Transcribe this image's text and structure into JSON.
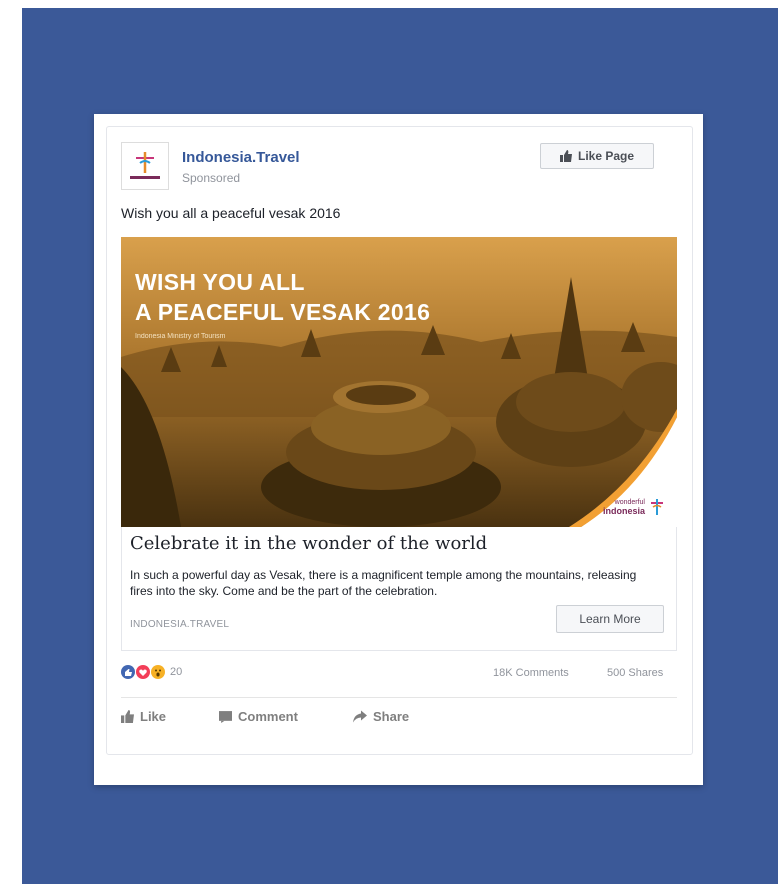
{
  "post": {
    "page_name": "Indonesia.Travel",
    "sponsored_label": "Sponsored",
    "like_page_label": "Like Page",
    "text": "Wish you all a peaceful vesak 2016"
  },
  "hero": {
    "title_line1": "WISH YOU ALL",
    "title_line2": "A PEACEFUL VESAK 2016",
    "subtitle": "Indonesia Ministry of Tourism",
    "logo_top": "wonderful",
    "logo_bottom": "indonesia"
  },
  "link": {
    "title": "Celebrate it in the wonder of the world",
    "description": "In such a powerful day as Vesak, there is a magnificent temple among the mountains, releasing fires into the sky. Come and be the part of the celebration.",
    "domain": "INDONESIA.TRAVEL",
    "cta_label": "Learn More"
  },
  "stats": {
    "reaction_count": "20",
    "comments": "18K Comments",
    "shares": "500 Shares",
    "reactions": [
      "like-reaction-icon",
      "love-reaction-icon",
      "wow-reaction-icon"
    ]
  },
  "actions": {
    "like": "Like",
    "comment": "Comment",
    "share": "Share"
  },
  "colors": {
    "background": "#3b5998",
    "link_blue": "#365899",
    "hero_tint": "#b7842f"
  }
}
